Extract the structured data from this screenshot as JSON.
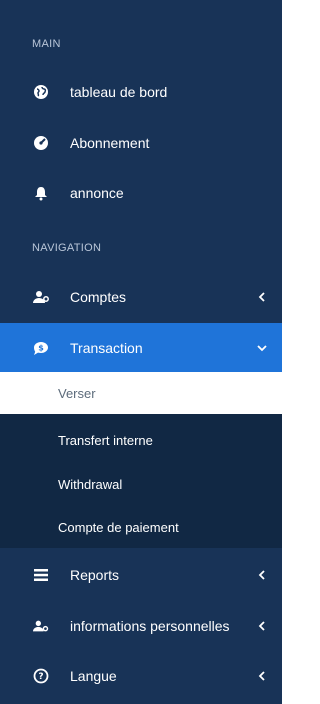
{
  "sections": {
    "main": "MAIN",
    "navigation": "NAVIGATION"
  },
  "menu": {
    "dashboard": "tableau de bord",
    "subscription": "Abonnement",
    "announcement": "annonce",
    "accounts": "Comptes",
    "transaction": "Transaction",
    "reports": "Reports",
    "personal_info": "informations personnelles",
    "language": "Langue"
  },
  "submenu": {
    "deposit": "Verser",
    "internal_transfer": "Transfert interne",
    "withdrawal": "Withdrawal",
    "payment_account": "Compte de paiement"
  },
  "icons": {
    "dashboard": "globe-icon",
    "subscription": "gauge-icon",
    "announcement": "bell-icon",
    "accounts": "users-cog-icon",
    "transaction": "money-bubble-icon",
    "reports": "list-icon",
    "personal_info": "user-settings-icon",
    "language": "question-circle-icon"
  },
  "colors": {
    "sidebar_bg": "#183357",
    "submenu_bg": "#112844",
    "active_bg": "#1f74d9",
    "text": "#ffffff"
  }
}
